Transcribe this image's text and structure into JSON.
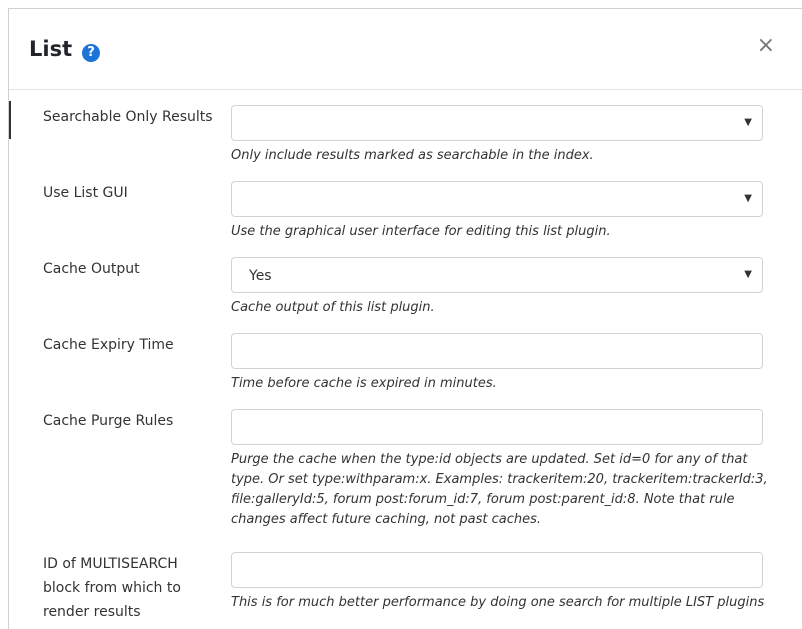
{
  "dialog": {
    "title": "List",
    "close_label": "×",
    "help_glyph": "?"
  },
  "fields": [
    {
      "label": "Searchable Only Results",
      "type": "select",
      "value": "",
      "help": "Only include results marked as searchable in the index."
    },
    {
      "label": "Use List GUI",
      "type": "select",
      "value": "",
      "help": "Use the graphical user interface for editing this list plugin."
    },
    {
      "label": "Cache Output",
      "type": "select",
      "value": "Yes",
      "help": "Cache output of this list plugin."
    },
    {
      "label": "Cache Expiry Time",
      "type": "text",
      "value": "",
      "help": "Time before cache is expired in minutes."
    },
    {
      "label": "Cache Purge Rules",
      "type": "text",
      "value": "",
      "help": "Purge the cache when the type:id objects are updated. Set id=0 for any of that type. Or set type:withparam:x. Examples: trackeritem:20, trackeritem:trackerId:3, file:galleryId:5, forum post:forum_id:7, forum post:parent_id:8. Note that rule changes affect future caching, not past caches."
    },
    {
      "label": "ID of MULTISEARCH block from which to render results",
      "type": "text",
      "value": "",
      "help": "This is for much better performance by doing one search for multiple LIST plugins"
    }
  ],
  "colors": {
    "accent": "#1d73d8",
    "border": "#ced4da"
  }
}
